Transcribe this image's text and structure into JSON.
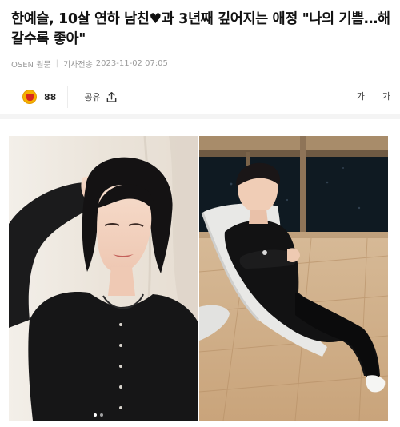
{
  "article": {
    "headline_part1": "한예슬, 10살 연하 남친",
    "heart_symbol": "♥",
    "headline_part2": "과 3년째 깊어지는 애정 \"나의 기쁨…해 갈수록 좋아\""
  },
  "meta": {
    "source": "OSEN 원문",
    "sent_label": "기사전송",
    "datetime": "2023-11-02 07:05"
  },
  "actions": {
    "reaction_count": "88",
    "share_label": "공유",
    "font_small": "가",
    "font_large": "가"
  },
  "icons": {
    "reaction": "reaction-emoji-icon",
    "share": "share-icon"
  },
  "colors": {
    "reaction_badge": "#f5b100",
    "headline": "#121212",
    "meta": "#9a9a9a"
  },
  "gallery": {
    "images": [
      "woman-portrait-photo",
      "man-reclining-photo"
    ],
    "indicator_count": 2,
    "active_index": 0
  }
}
